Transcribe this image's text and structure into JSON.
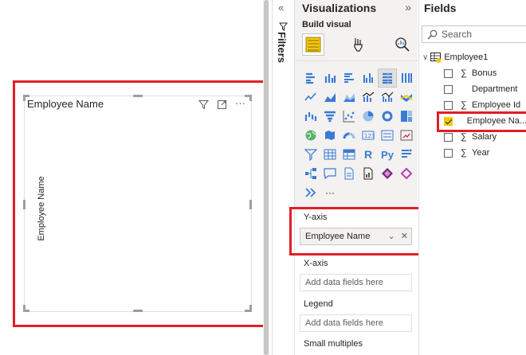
{
  "canvas": {
    "visual": {
      "title": "Employee Name",
      "y_axis_label": "Employee Name",
      "header_icons": [
        "filter-icon",
        "focus-mode-icon",
        "more-options-icon"
      ]
    }
  },
  "filters_pane": {
    "label": "Filters",
    "collapse_glyph": "«"
  },
  "visualizations_pane": {
    "title": "Visualizations",
    "expand_glyph": "»",
    "build_label": "Build visual",
    "build_tabs": [
      "build-visual-icon",
      "format-visual-icon",
      "analytics-icon"
    ],
    "more_glyph": "···",
    "wells": [
      {
        "label": "Y-axis",
        "field": "Employee Name",
        "filled": true
      },
      {
        "label": "X-axis",
        "field": "Add data fields here",
        "filled": false
      },
      {
        "label": "Legend",
        "field": "Add data fields here",
        "filled": false
      },
      {
        "label": "Small multiples"
      }
    ]
  },
  "fields_pane": {
    "title": "Fields",
    "search_placeholder": "Search",
    "table": "Employee1",
    "fields": [
      {
        "name": "Bonus",
        "sigma": true,
        "checked": false
      },
      {
        "name": "Department",
        "sigma": false,
        "checked": false
      },
      {
        "name": "Employee Id",
        "sigma": true,
        "checked": false
      },
      {
        "name": "Employee Na...",
        "sigma": false,
        "checked": true
      },
      {
        "name": "Salary",
        "sigma": true,
        "checked": false
      },
      {
        "name": "Year",
        "sigma": true,
        "checked": false
      }
    ]
  },
  "colors": {
    "highlight": "#e01f27",
    "accent_yellow": "#f2c811",
    "icon_blue": "#3a7bd5",
    "pane_bg": "#f3f2f1"
  }
}
